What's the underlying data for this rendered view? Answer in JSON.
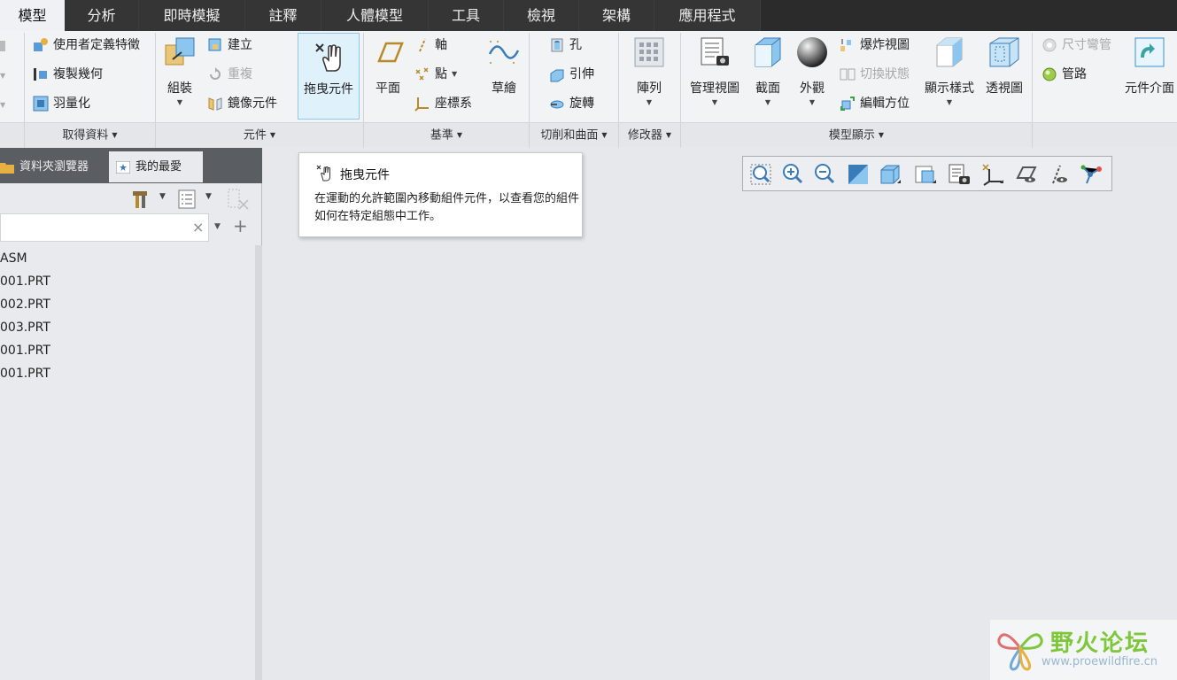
{
  "tabs": [
    "模型",
    "分析",
    "即時模擬",
    "註釋",
    "人體模型",
    "工具",
    "檢視",
    "架構",
    "應用程式"
  ],
  "active_tab": "模型",
  "ribbon": {
    "get_data": {
      "label": "取得資料",
      "items": [
        "使用者定義特徵",
        "複製幾何",
        "羽量化"
      ]
    },
    "components": {
      "label": "元件",
      "assemble": "組裝",
      "create": "建立",
      "repeat": "重複",
      "mirror": "鏡像元件",
      "drag": "拖曳元件"
    },
    "datum": {
      "label": "基準",
      "plane": "平面",
      "axis": "軸",
      "point": "點",
      "csys": "座標系",
      "sketch": "草繪"
    },
    "cut_surface": {
      "label": "切削和曲面",
      "hole": "孔",
      "extrude": "引伸",
      "revolve": "旋轉"
    },
    "modifiers": {
      "label": "修改器",
      "pattern": "陣列"
    },
    "model_display": {
      "label": "模型顯示",
      "manage_views": "管理視圖",
      "section": "截面",
      "appearance": "外觀",
      "explode_view": "爆炸視圖",
      "toggle_status": "切換狀態",
      "edit_position": "編輯方位",
      "display_style": "顯示樣式",
      "perspective": "透視圖"
    },
    "extra": {
      "dim_bend": "尺寸彎管",
      "piping": "管路",
      "component_interface": "元件介面"
    }
  },
  "left_panel": {
    "tabs": [
      "資料夾瀏覽器",
      "我的最愛"
    ],
    "tree": [
      "ASM",
      "001.PRT",
      "002.PRT",
      "003.PRT",
      "001.PRT",
      "001.PRT"
    ],
    "search_clear": "×",
    "search_add": "+"
  },
  "tooltip": {
    "title": "拖曳元件",
    "description": "在運動的允許範圍內移動組件元件，以查看您的組件如何在特定組態中工作。"
  },
  "view_toolbar": [
    "refit-icon",
    "zoom-in-icon",
    "zoom-out-icon",
    "repaint-icon",
    "saved-orientations-icon",
    "view-manager-icon",
    "camera-icon",
    "datum-display-icon",
    "plane-display-icon",
    "axis-display-icon",
    "spin-center-icon"
  ],
  "watermark": {
    "title": "野火论坛",
    "url": "www.proewildfire.cn"
  },
  "colors": {
    "tabbar": "#2b2b2b",
    "ribbon": "#f2f3f5",
    "selected": "#dff1fb",
    "accent": "#3a8fd0"
  }
}
